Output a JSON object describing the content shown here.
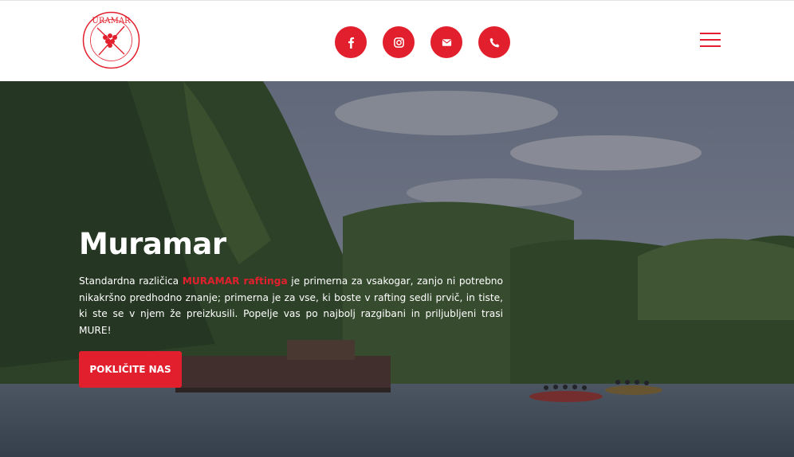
{
  "header": {
    "logo_text": "URAMAR",
    "social": [
      {
        "name": "facebook-icon",
        "link": "Facebook"
      },
      {
        "name": "instagram-icon",
        "link": "Instagram"
      },
      {
        "name": "email-icon",
        "link": "Email"
      },
      {
        "name": "phone-icon",
        "link": "Phone"
      }
    ]
  },
  "hero": {
    "title": "Muramar",
    "text_before": "Standardna različica ",
    "highlight": "MURAMAR raftinga",
    "text_after": " je primerna za vsakogar, zanjo ni potrebno nikakršno predhodno znanje; primerna je za vse, ki boste v rafting sedli prvič, in tiste, ki ste se v njem že preizkusili. Popelje vas po najbolj razgibani in priljubljeni trasi MURE!",
    "cta_label": "POKLIČITE NAS"
  },
  "colors": {
    "accent": "#e21f2d"
  }
}
